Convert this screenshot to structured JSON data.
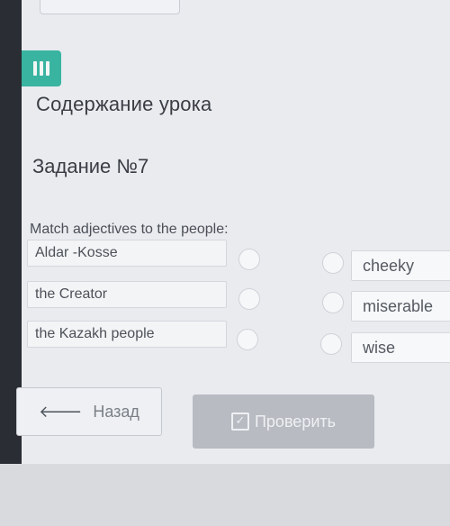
{
  "header": {
    "lesson_title": "Содержание урока"
  },
  "task": {
    "title": "Задание №7",
    "instruction": "Match adjectives to the people:",
    "left_items": [
      "Aldar -Kosse",
      "the Creator",
      "the Kazakh people"
    ],
    "right_items": [
      "cheeky",
      "miserable",
      "wise"
    ]
  },
  "buttons": {
    "back_label": "Назад",
    "check_label": "Проверить"
  },
  "icons": {
    "menu": "menu-icon",
    "back": "arrow-left-icon",
    "check": "checkbox-icon"
  },
  "colors": {
    "accent": "#39b4a1",
    "disabled": "#b8bbc1"
  }
}
